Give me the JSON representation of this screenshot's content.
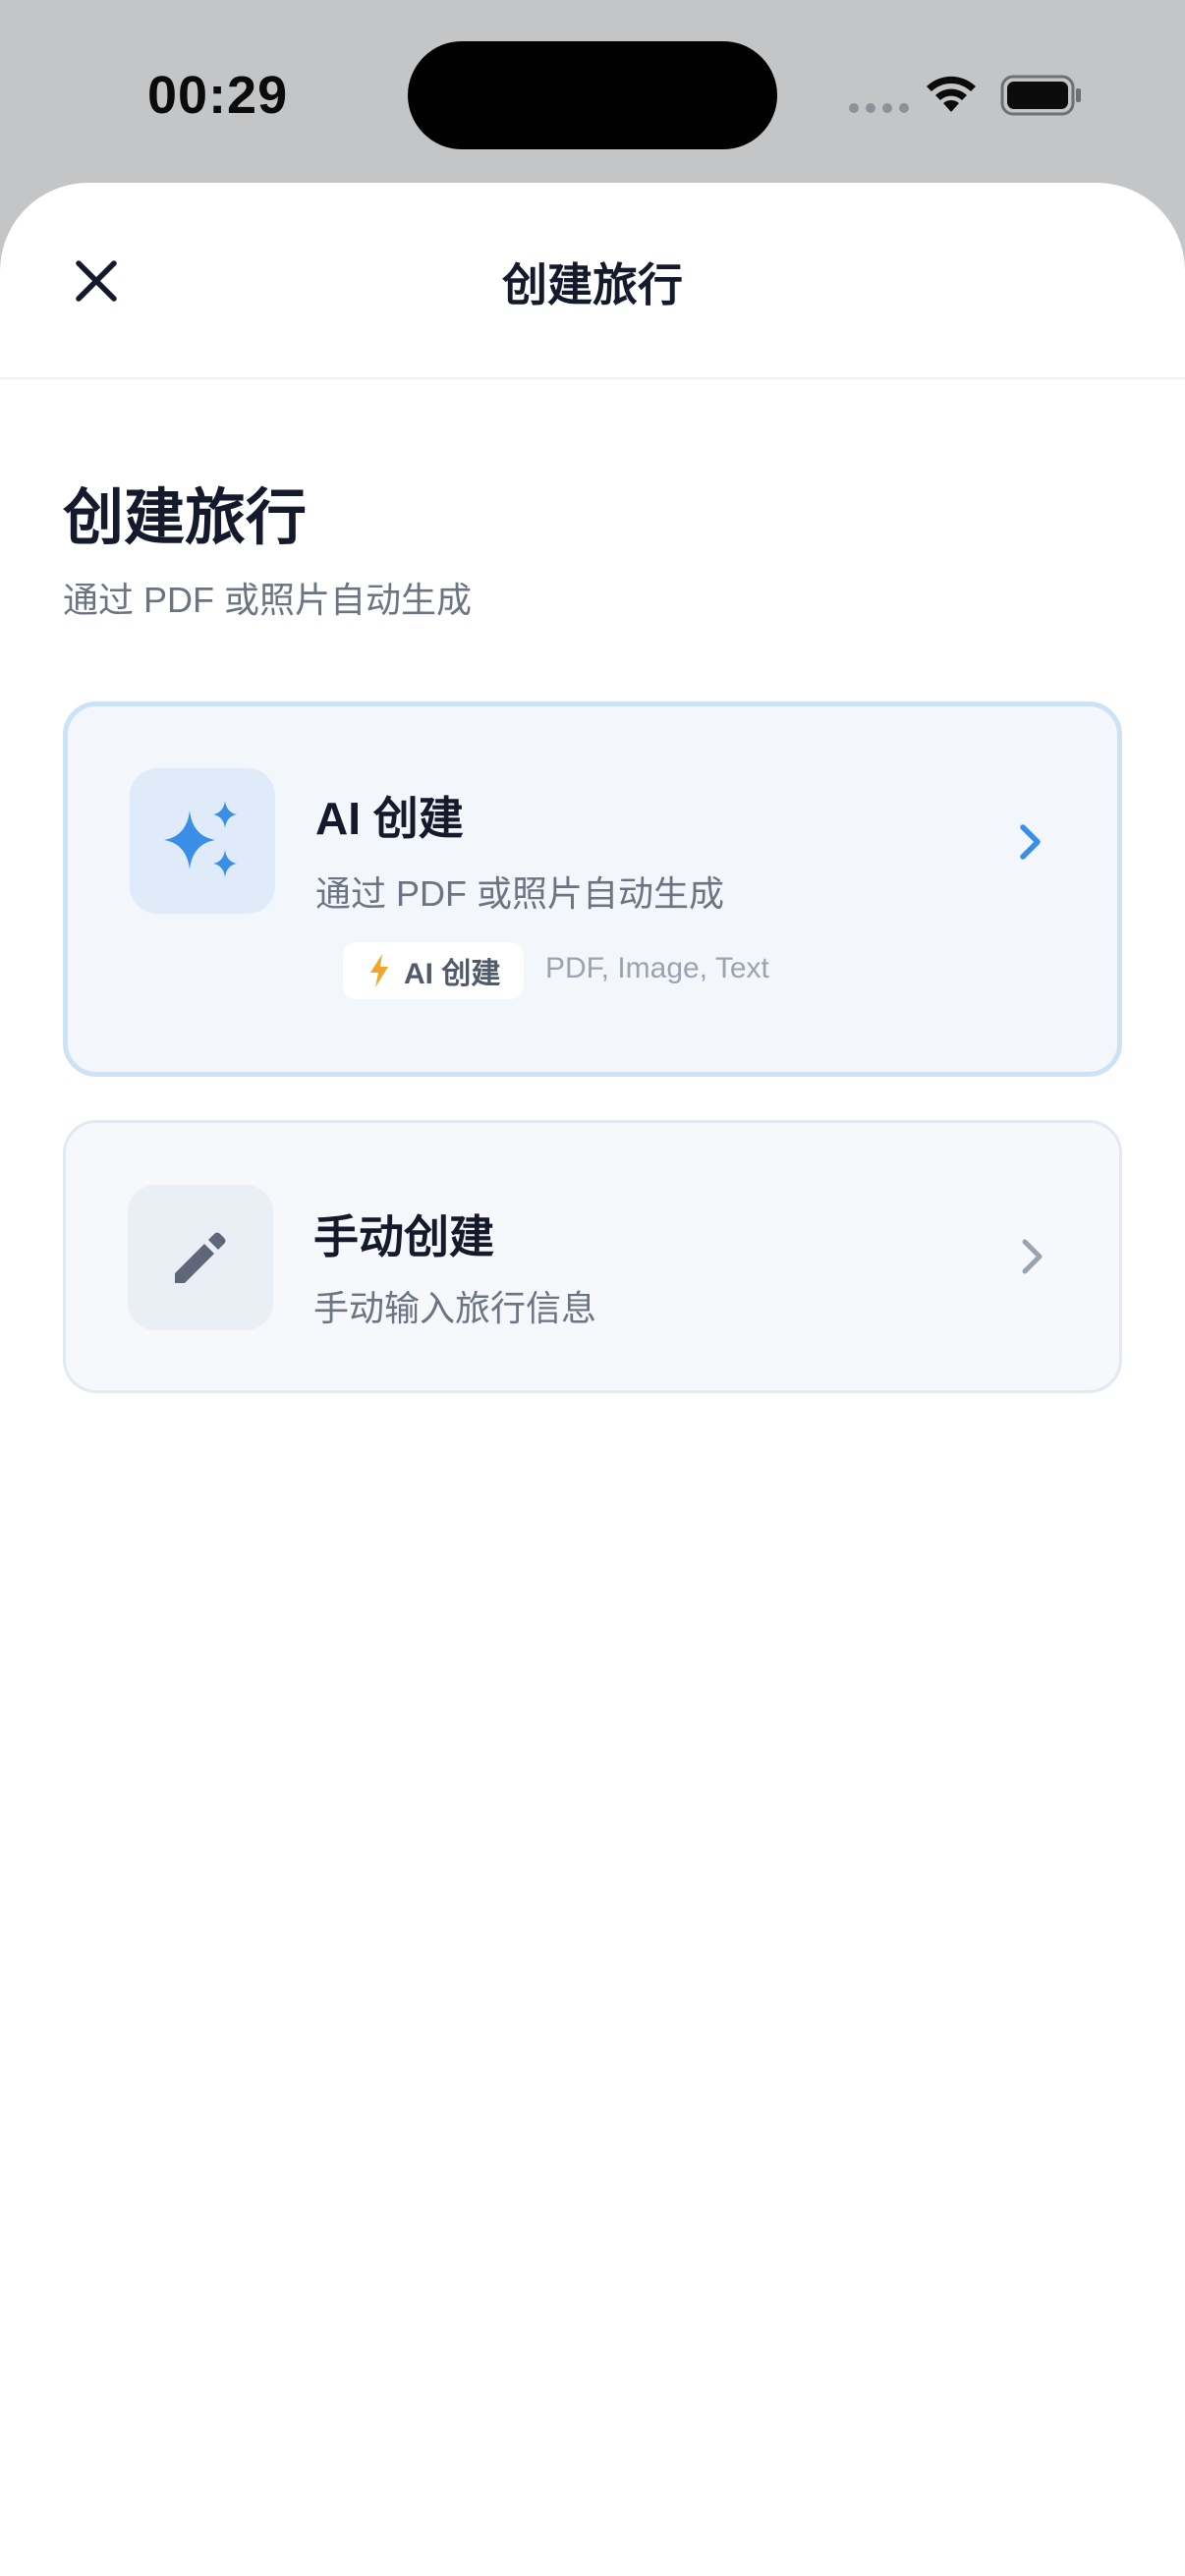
{
  "status_bar": {
    "time": "00:29"
  },
  "nav": {
    "title": "创建旅行",
    "close_icon": "close-icon"
  },
  "header": {
    "title": "创建旅行",
    "subtitle": "通过 PDF 或照片自动生成"
  },
  "options": {
    "ai": {
      "icon": "sparkles-icon",
      "title": "AI 创建",
      "subtitle": "通过 PDF 或照片自动生成",
      "chip_icon": "lightning-icon",
      "chip_label": "AI 创建",
      "formats": "PDF, Image, Text"
    },
    "manual": {
      "icon": "pencil-icon",
      "title": "手动创建",
      "subtitle": "手动输入旅行信息"
    }
  },
  "colors": {
    "accent_blue": "#3a8ee6",
    "chip_lightning": "#f2a52b",
    "title_text": "#141a2b",
    "secondary_text": "#6b7483"
  }
}
